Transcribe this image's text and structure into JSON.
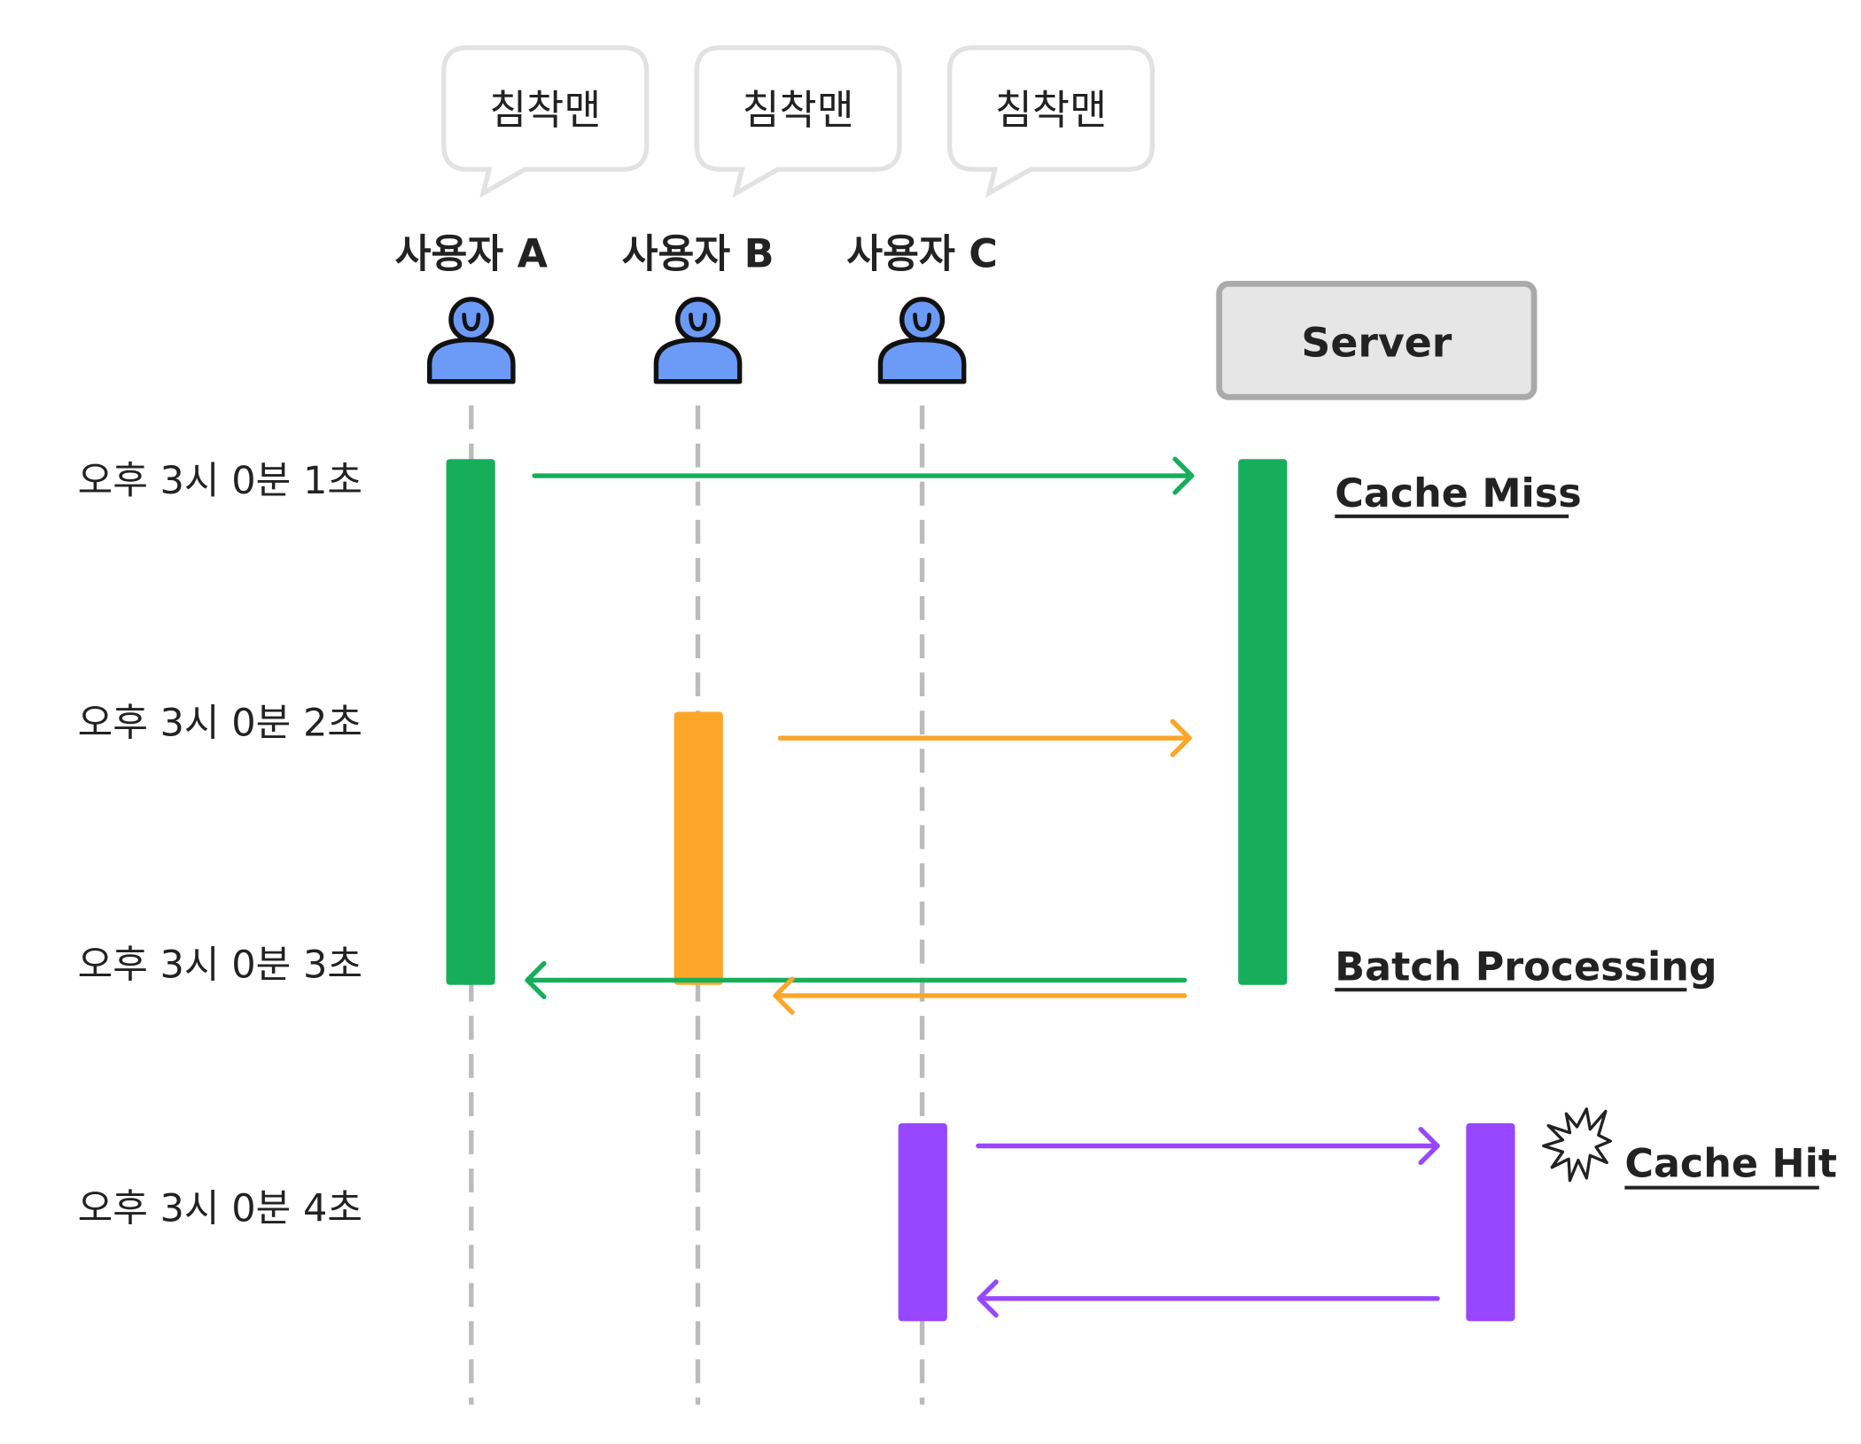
{
  "bubbles": [
    "침착맨",
    "침착맨",
    "침착맨"
  ],
  "actors": [
    {
      "label": "사용자 A",
      "icon": "user-icon"
    },
    {
      "label": "사용자 B",
      "icon": "user-icon"
    },
    {
      "label": "사용자 C",
      "icon": "user-icon"
    }
  ],
  "server": {
    "label": "Server"
  },
  "times": [
    "오후 3시 0분 1초",
    "오후 3시 0분 2초",
    "오후 3시 0분 3초",
    "오후 3시 0분 4초"
  ],
  "annotations": {
    "cache_miss": "Cache Miss",
    "batch": "Batch Processing",
    "cache_hit": "Cache Hit",
    "cache_hit_icon": "starburst-icon"
  },
  "colors": {
    "user_a": "#16ae5b",
    "user_b": "#fca629",
    "user_c": "#9747ff",
    "person": "#6b9bf7",
    "lifeline": "#bbbbbb",
    "server_fill": "#e6e6e6"
  }
}
